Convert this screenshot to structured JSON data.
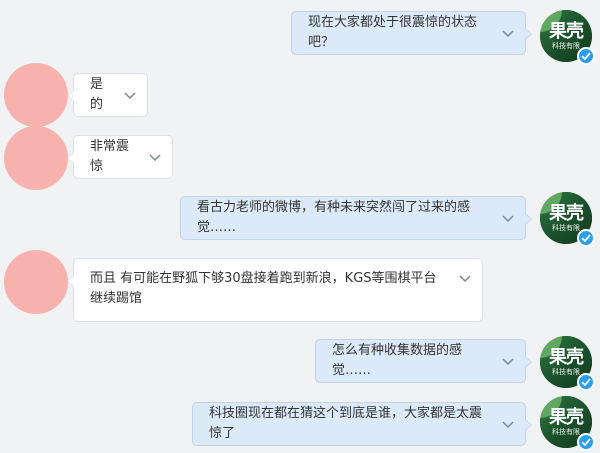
{
  "brand_avatar": {
    "title": "果壳",
    "subtitle": "科技有限",
    "verified_icon": "verified-check-icon"
  },
  "colors": {
    "incoming_bubble": "#ffffff",
    "outgoing_bubble": "#dbe9f8",
    "user_avatar": "#f7b2ad",
    "brand_green": "#1f5a32",
    "verified_blue": "#2a9df4"
  },
  "messages": [
    {
      "side": "right",
      "text": "现在大家都处于很震惊的状态吧？"
    },
    {
      "side": "left",
      "text": "是的"
    },
    {
      "side": "left",
      "text": "非常震惊"
    },
    {
      "side": "right",
      "text": "看古力老师的微博，有种未来突然闯了过来的感觉……"
    },
    {
      "side": "left",
      "text": "而且 有可能在野狐下够30盘接着跑到新浪，KGS等围棋平台继续踢馆"
    },
    {
      "side": "right",
      "text": "怎么有种收集数据的感觉……"
    },
    {
      "side": "right",
      "text": "科技圈现在都在猜这个到底是谁，大家都是太震惊了"
    }
  ]
}
